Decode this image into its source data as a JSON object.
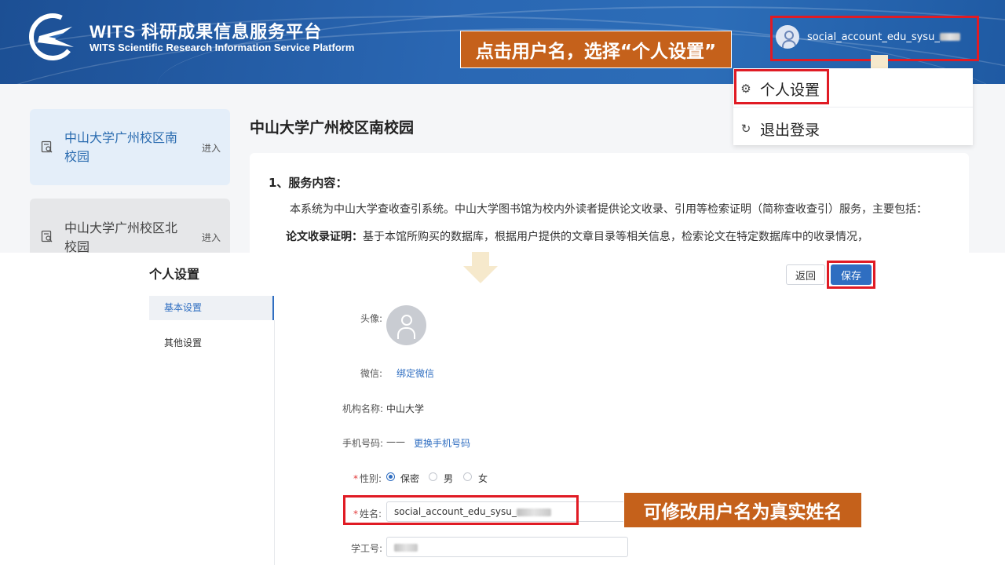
{
  "header": {
    "logo_title": "WITS 科研成果信息服务平台",
    "logo_subtitle": "WITS Scientific Research Information Service Platform",
    "username": "social_account_edu_sysu_",
    "username_blur": "",
    "callout": "点击用户名，选择“个人设置”"
  },
  "dropdown": {
    "items": [
      {
        "label": "个人设置",
        "icon": "gear-icon"
      },
      {
        "label": "退出登录",
        "icon": "logout-icon"
      }
    ]
  },
  "sidebar": {
    "campuses": [
      {
        "line1": "中山大学广州校区南",
        "line2": "校园",
        "action": "进入"
      },
      {
        "line1": "中山大学广州校区北",
        "line2": "校园",
        "action": "进入"
      }
    ]
  },
  "main": {
    "title": "中山大学广州校区南校园",
    "service_heading": "1、服务内容：",
    "service_intro": "本系统为中山大学查收查引系统。中山大学图书馆为校内外读者提供论文收录、引用等检索证明（简称查收查引）服务，主要包括：",
    "paper_label": "论文收录证明：",
    "paper_text": "基于本馆所购买的数据库，根据用户提供的文章目录等相关信息，检索论文在特定数据库中的收录情况，"
  },
  "settings": {
    "title": "个人设置",
    "back_label": "返回",
    "save_label": "保存",
    "nav": [
      {
        "label": "基本设置",
        "active": true
      },
      {
        "label": "其他设置",
        "active": false
      }
    ],
    "avatar_label": "头像:",
    "wechat_label": "微信:",
    "wechat_link": "绑定微信",
    "org_label": "机构名称:",
    "org_value": "中山大学",
    "phone_label": "手机号码:",
    "phone_value": "——",
    "phone_link": "更换手机号码",
    "gender_label": "性别:",
    "gender_options": [
      "保密",
      "男",
      "女"
    ],
    "gender_selected": "保密",
    "name_label": "姓名:",
    "name_value": "social_account_edu_sysu_",
    "staff_label": "学工号:",
    "staff_value": "",
    "callout": "可修改用户名为真实姓名"
  },
  "colors": {
    "header_blue": "#2a67b3",
    "callout_orange": "#c5611b",
    "highlight_red": "#e01b24",
    "primary_blue": "#2f6ec1"
  }
}
